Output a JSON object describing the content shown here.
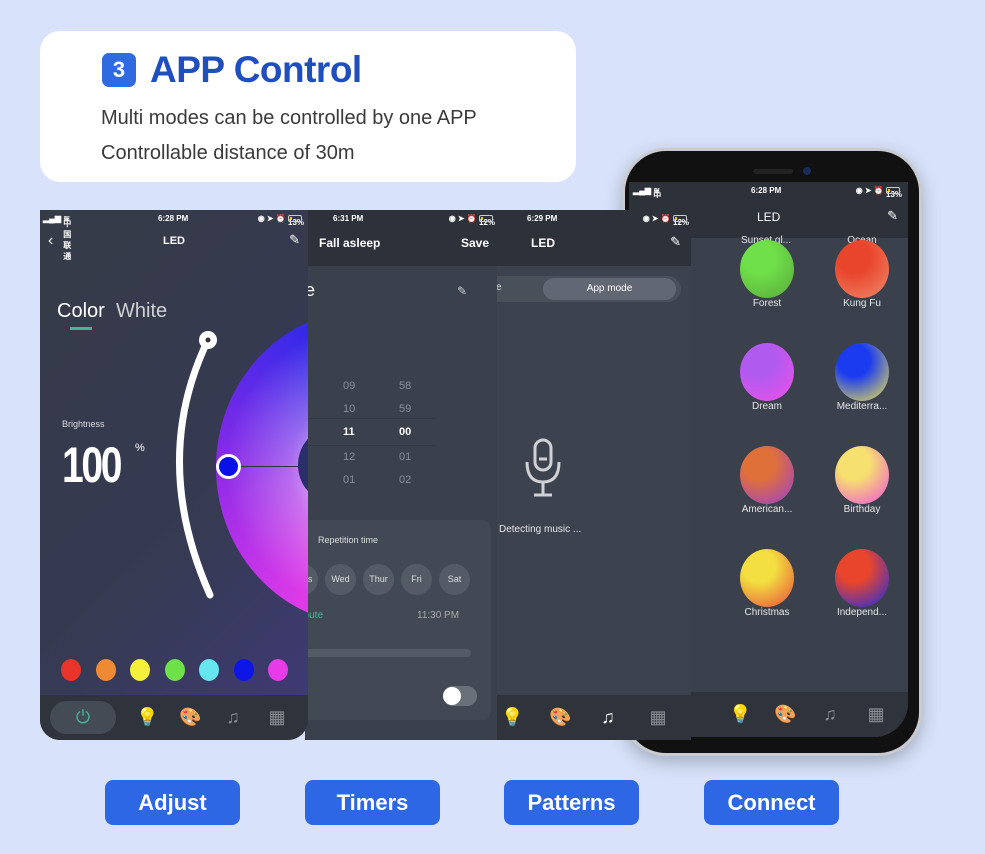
{
  "header": {
    "badge": "3",
    "title": "APP Control",
    "line1": "Multi modes can be controlled by one APP",
    "line2": "Controllable distance of 30m"
  },
  "screen1": {
    "carrier": "中国联通",
    "time": "6:28 PM",
    "battery": "13%",
    "title": "LED",
    "tab_color": "Color",
    "tab_white": "White",
    "brightness_label": "Brightness",
    "brightness_value": "100",
    "brightness_unit": "%",
    "brightness_fraction": 1.0,
    "swatches": [
      "#e8342a",
      "#ef8a34",
      "#f5f03c",
      "#6ee04a",
      "#66e6ef",
      "#0d16e6",
      "#e83be8"
    ],
    "selected_color": "#0a10e8"
  },
  "screen2": {
    "time": "6:31 PM",
    "battery": "12%",
    "title": "Fall asleep",
    "save": "Save",
    "name_partial": "e",
    "hours": [
      "09",
      "10",
      "11",
      "12",
      "01"
    ],
    "minutes": [
      "58",
      "59",
      "00",
      "01",
      "02"
    ],
    "repetition_label": "Repetition time",
    "days": [
      "Tues",
      "Wed",
      "Thur",
      "Fri",
      "Sat"
    ],
    "minute_label": "Minute",
    "end_time": "11:30 PM",
    "toggle_on": false
  },
  "screen3": {
    "time": "6:29 PM",
    "battery": "12%",
    "title": "LED",
    "mode_left": "e",
    "mode_right": "App mode",
    "detecting": "Detecting music ..."
  },
  "screen4": {
    "carrier": "中国联通",
    "time": "6:28 PM",
    "battery": "13%",
    "title": "LED",
    "top_labels": [
      "Sunset gl...",
      "Ocean"
    ],
    "patterns": [
      {
        "label": "Forest",
        "colors": [
          "#6fe04a",
          "#5aa83a"
        ]
      },
      {
        "label": "Kung Fu",
        "colors": [
          "#e8452c",
          "#f08a6a"
        ]
      },
      {
        "label": "Dream",
        "colors": [
          "#b05af0",
          "#f050e8"
        ]
      },
      {
        "label": "Mediterra...",
        "colors": [
          "#1a3bf0",
          "#f3e84a"
        ]
      },
      {
        "label": "American...",
        "colors": [
          "#e0703a",
          "#9a3ed0"
        ]
      },
      {
        "label": "Birthday",
        "colors": [
          "#f6e070",
          "#f050d8"
        ]
      },
      {
        "label": "Christmas",
        "colors": [
          "#f3e040",
          "#e84a3a"
        ]
      },
      {
        "label": "Independ...",
        "colors": [
          "#e8452c",
          "#1a2be8"
        ]
      }
    ]
  },
  "buttons": [
    "Adjust",
    "Timers",
    "Patterns",
    "Connect"
  ]
}
